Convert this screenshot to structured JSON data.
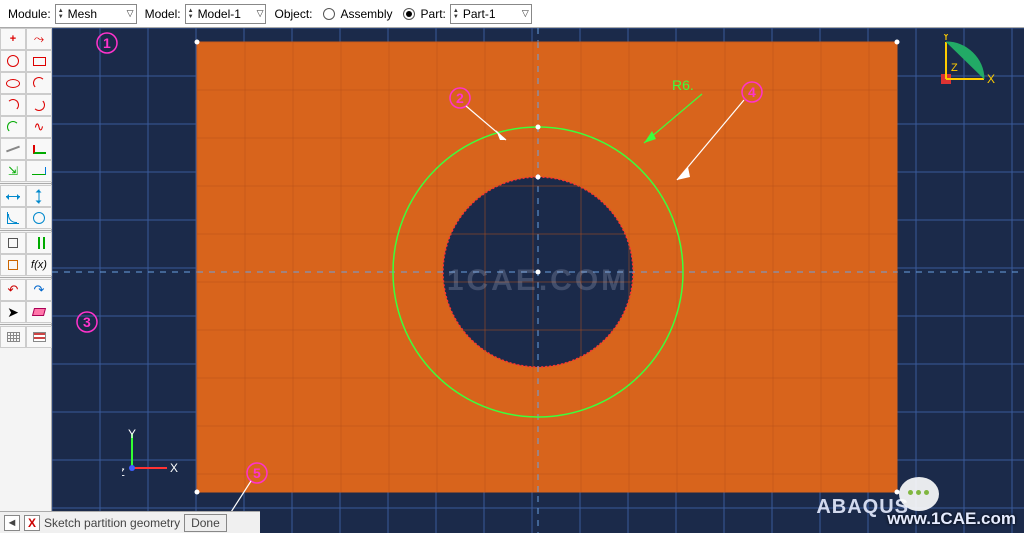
{
  "context": {
    "module_label": "Module:",
    "module_value": "Mesh",
    "model_label": "Model:",
    "model_value": "Model-1",
    "object_label": "Object:",
    "assembly_label": "Assembly",
    "part_label": "Part:",
    "part_value": "Part-1",
    "object_selected": "part"
  },
  "annotations": {
    "c1": "1",
    "c2": "2",
    "c3": "3",
    "c4": "4",
    "c5": "5",
    "radius_label": "R6."
  },
  "axes": {
    "x": "X",
    "y": "Y",
    "z": "Z"
  },
  "watermark": "1CAE.COM",
  "brand_text": "ABAQUS",
  "footer_url": "www.1CAE.com",
  "prompt": {
    "text": "Sketch partition geometry",
    "done": "Done"
  },
  "tools": {
    "point": "point",
    "line": "line",
    "circle": "circle",
    "rect": "rect",
    "ellipse": "ellipse",
    "arc_tan": "arc-tan",
    "arc_c": "arc-center",
    "arc_3p": "arc-3pt",
    "fillet": "fillet",
    "spline": "spline",
    "construction": "construction",
    "offset": "offset",
    "project": "project",
    "trim": "trim",
    "dim_h": "dim-h",
    "dim_v": "dim-v",
    "dim_ang": "dim-ang",
    "dim_rad": "dim-rad",
    "con_perp": "con-perp",
    "con_para": "con-para",
    "con_eq": "con-eq",
    "param": "fx",
    "undo": "undo",
    "redo": "redo",
    "select": "select",
    "eraser": "eraser",
    "grid_opts": "grid",
    "sketch_opts": "opts"
  }
}
